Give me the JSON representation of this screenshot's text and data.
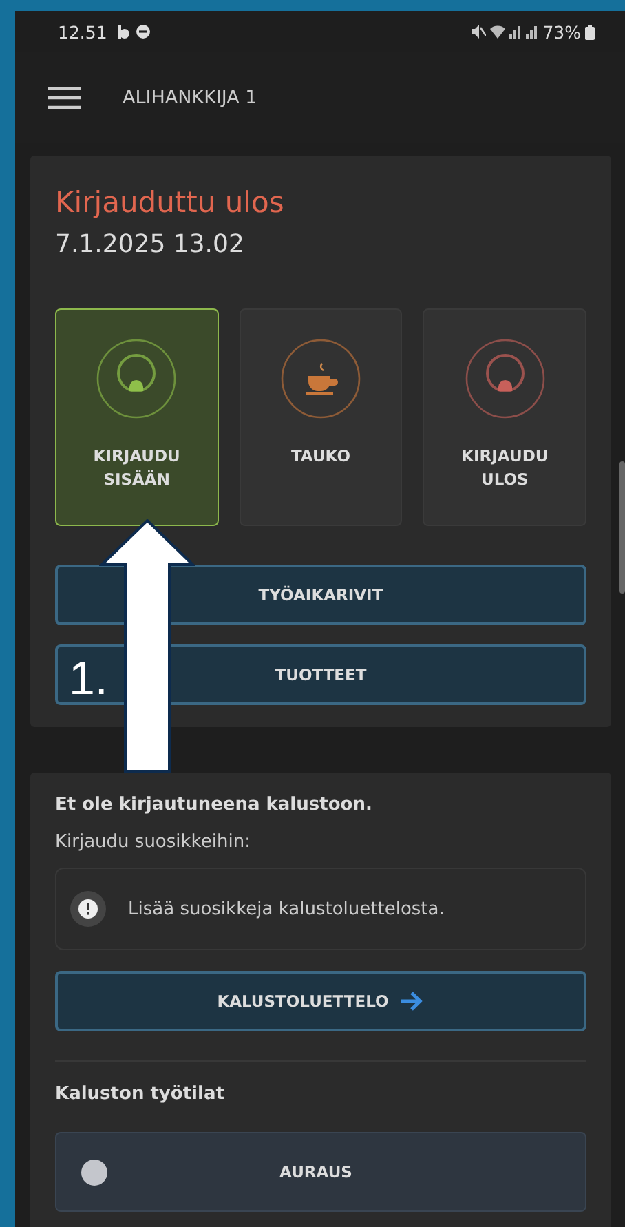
{
  "status_bar": {
    "time": "12.51",
    "battery": "73%"
  },
  "header": {
    "title": "ALIHANKKIJA 1"
  },
  "status": {
    "title": "Kirjauduttu ulos",
    "timestamp": "7.1.2025 13.02"
  },
  "tiles": [
    {
      "kind": "login",
      "label": "KIRJAUDU SISÄÄN",
      "selected": true
    },
    {
      "kind": "break",
      "label": "TAUKO",
      "selected": false
    },
    {
      "kind": "logout",
      "label": "KIRJAUDU ULOS",
      "selected": false
    }
  ],
  "actions": [
    "TYÖAIKARIVIT",
    "TUOTTEET"
  ],
  "equipment": {
    "notice": "Et ole kirjautuneena kalustoon.",
    "favorites_label": "Kirjaudu suosikkeihin:",
    "info": "Lisää suosikkeja kalustoluettelosta.",
    "list_button": "KALUSTOLUETTELO",
    "modes_title": "Kaluston työtilat",
    "modes": [
      {
        "label": "AURAUS",
        "selected": false
      }
    ]
  },
  "annotation": {
    "label": "1."
  }
}
